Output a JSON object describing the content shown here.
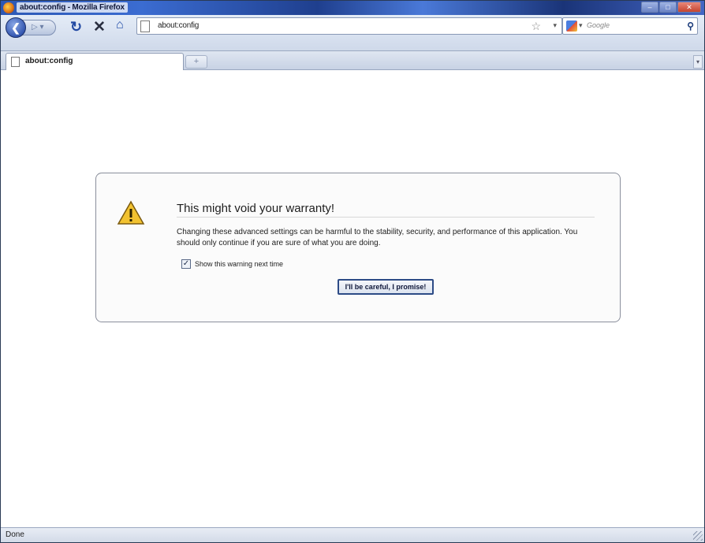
{
  "window": {
    "title": "about:config - Mozilla Firefox"
  },
  "navbar": {
    "url": "about:config",
    "search_placeholder": "Google"
  },
  "tabs": [
    {
      "label": "about:config"
    }
  ],
  "warning": {
    "title": "This might void your warranty!",
    "body": "Changing these advanced settings can be harmful to the stability, security, and performance of this application. You should only continue if you are sure of what you are doing.",
    "checkbox_label": "Show this warning next time",
    "checkbox_checked": true,
    "button_label": "I'll be careful, I promise!"
  },
  "statusbar": {
    "text": "Done"
  },
  "icons": {
    "back": "back-arrow-icon",
    "forward": "forward-arrow-icon",
    "reload": "reload-icon",
    "stop": "stop-icon",
    "home": "home-icon",
    "bookmark": "star-icon",
    "warning": "warning-triangle-icon"
  }
}
